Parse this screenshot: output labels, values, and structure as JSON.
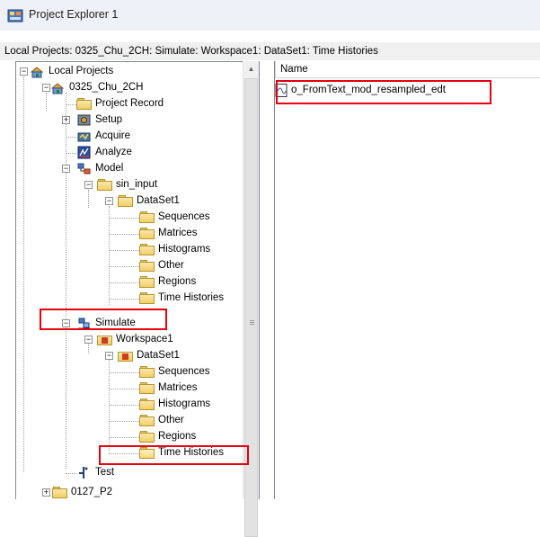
{
  "window": {
    "title": "Project Explorer 1"
  },
  "path": {
    "text": "Local Projects: 0325_Chu_2CH: Simulate: Workspace1: DataSet1: Time Histories"
  },
  "tree": {
    "items": [
      {
        "label": "Local Projects",
        "icon": "project-group-icon"
      },
      {
        "label": "0325_Chu_2CH",
        "icon": "project-icon"
      },
      {
        "label": "Project Record",
        "icon": "folder-icon"
      },
      {
        "label": "Setup",
        "icon": "setup-icon"
      },
      {
        "label": "Acquire",
        "icon": "acquire-icon"
      },
      {
        "label": "Analyze",
        "icon": "analyze-icon"
      },
      {
        "label": "Model",
        "icon": "model-icon"
      },
      {
        "label": "sin_input",
        "icon": "folder-icon"
      },
      {
        "label": "DataSet1",
        "icon": "folder-icon"
      },
      {
        "label": "Sequences",
        "icon": "folder-icon"
      },
      {
        "label": "Matrices",
        "icon": "folder-icon"
      },
      {
        "label": "Histograms",
        "icon": "folder-icon"
      },
      {
        "label": "Other",
        "icon": "folder-icon"
      },
      {
        "label": "Regions",
        "icon": "folder-icon"
      },
      {
        "label": "Time Histories",
        "icon": "folder-icon"
      },
      {
        "label": "Simulate",
        "icon": "simulate-icon"
      },
      {
        "label": "Workspace1",
        "icon": "workspace-icon"
      },
      {
        "label": "DataSet1",
        "icon": "workspace-icon"
      },
      {
        "label": "Sequences",
        "icon": "folder-icon"
      },
      {
        "label": "Matrices",
        "icon": "folder-icon"
      },
      {
        "label": "Histograms",
        "icon": "folder-icon"
      },
      {
        "label": "Other",
        "icon": "folder-icon"
      },
      {
        "label": "Regions",
        "icon": "folder-icon"
      },
      {
        "label": "Time Histories",
        "icon": "open-folder-icon"
      },
      {
        "label": "Test",
        "icon": "test-icon"
      },
      {
        "label": "0127_P2",
        "icon": "folder-icon"
      }
    ]
  },
  "list": {
    "column_header": "Name",
    "items": [
      {
        "label": "o_FromText_mod_resampled_edt",
        "icon": "time-history-file-icon"
      }
    ]
  },
  "colors": {
    "highlight": "#e8000f",
    "folder": "#f1cf6a"
  }
}
